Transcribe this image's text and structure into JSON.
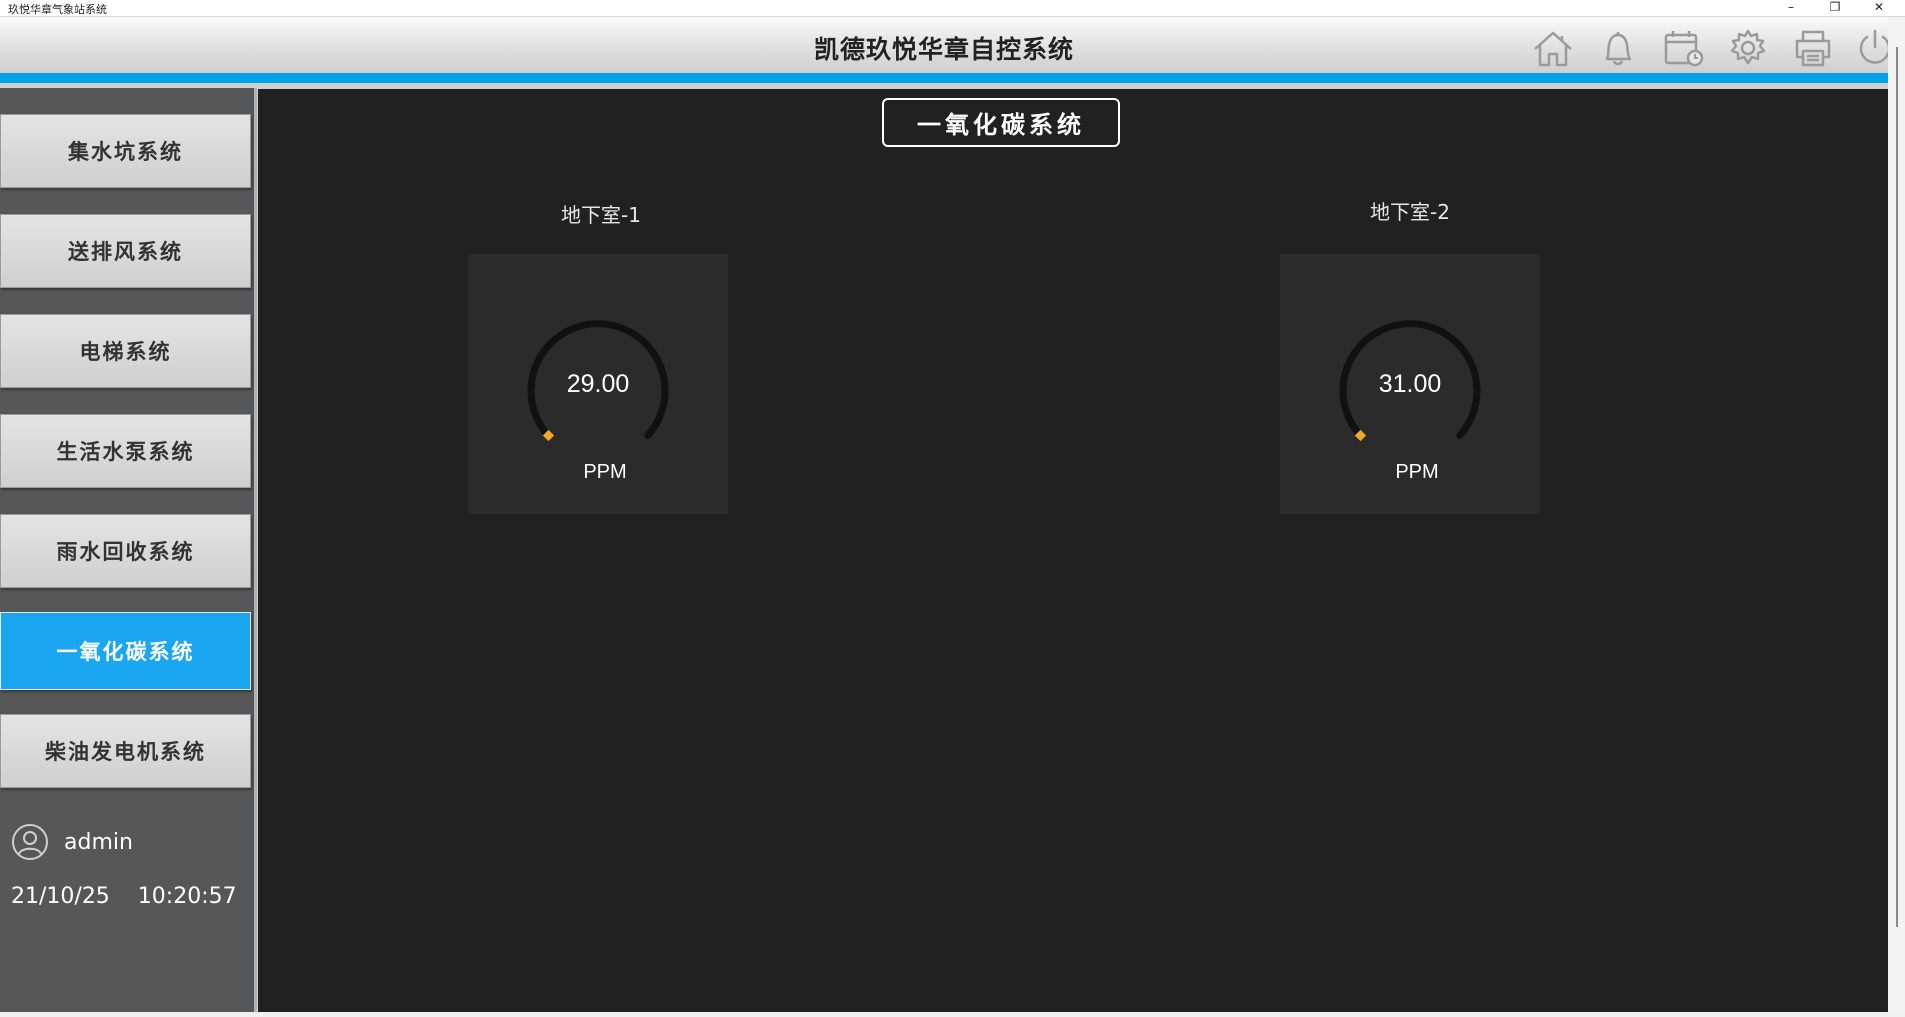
{
  "window": {
    "title": "玖悦华章气象站系统",
    "controls": {
      "minimize": "–",
      "restore": "❐",
      "close": "✕"
    }
  },
  "header": {
    "title": "凯德玖悦华章自控系统",
    "icons": [
      "home-icon",
      "bell-icon",
      "calendar-clock-icon",
      "gear-icon",
      "printer-icon",
      "power-icon"
    ],
    "accent_color": "#00a3e8"
  },
  "sidebar": {
    "items": [
      {
        "label": "集水坑系统",
        "active": false
      },
      {
        "label": "送排风系统",
        "active": false
      },
      {
        "label": "电梯系统",
        "active": false
      },
      {
        "label": "生活水泵系统",
        "active": false
      },
      {
        "label": "雨水回收系统",
        "active": false
      },
      {
        "label": "一氧化碳系统",
        "active": true
      },
      {
        "label": "柴油发电机系统",
        "active": false
      }
    ],
    "user": "admin",
    "date": "21/10/25",
    "time": "10:20:57"
  },
  "main": {
    "section_title": "一氧化碳系统",
    "gauges": [
      {
        "label": "地下室-1",
        "value": "29.00",
        "unit": "PPM",
        "fraction": 0.0
      },
      {
        "label": "地下室-2",
        "value": "31.00",
        "unit": "PPM",
        "fraction": 0.0
      }
    ],
    "indicator_color": "#f5a623"
  }
}
